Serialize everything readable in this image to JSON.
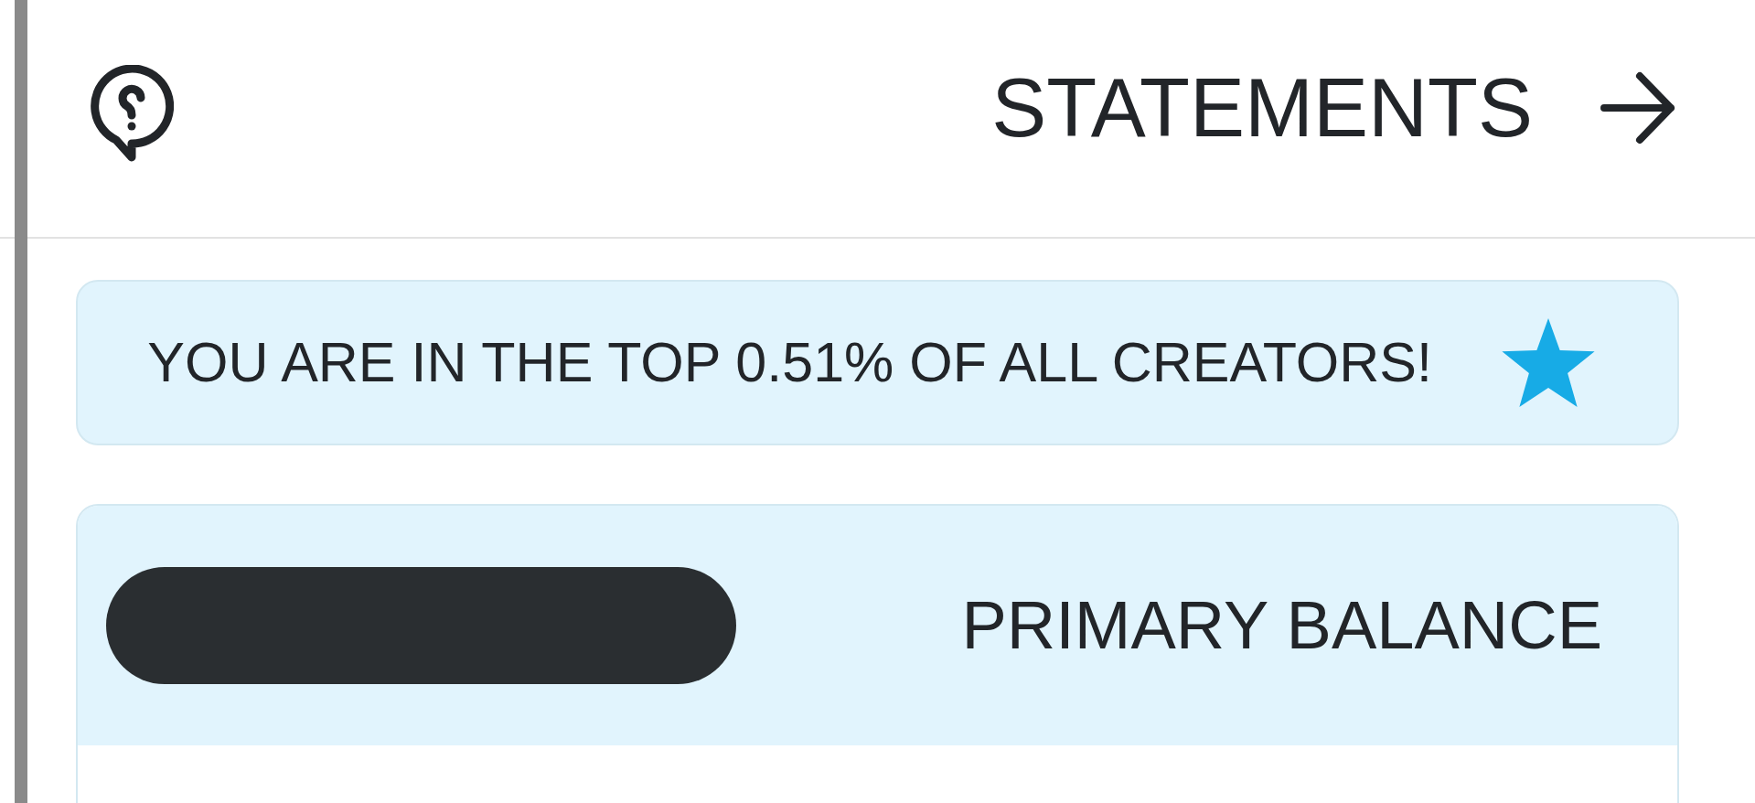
{
  "header": {
    "title": "STATEMENTS"
  },
  "rank_banner": {
    "text": "YOU ARE IN THE TOP 0.51% OF ALL CREATORS!"
  },
  "balance_card": {
    "label": "PRIMARY BALANCE",
    "amount_redacted": true
  }
}
